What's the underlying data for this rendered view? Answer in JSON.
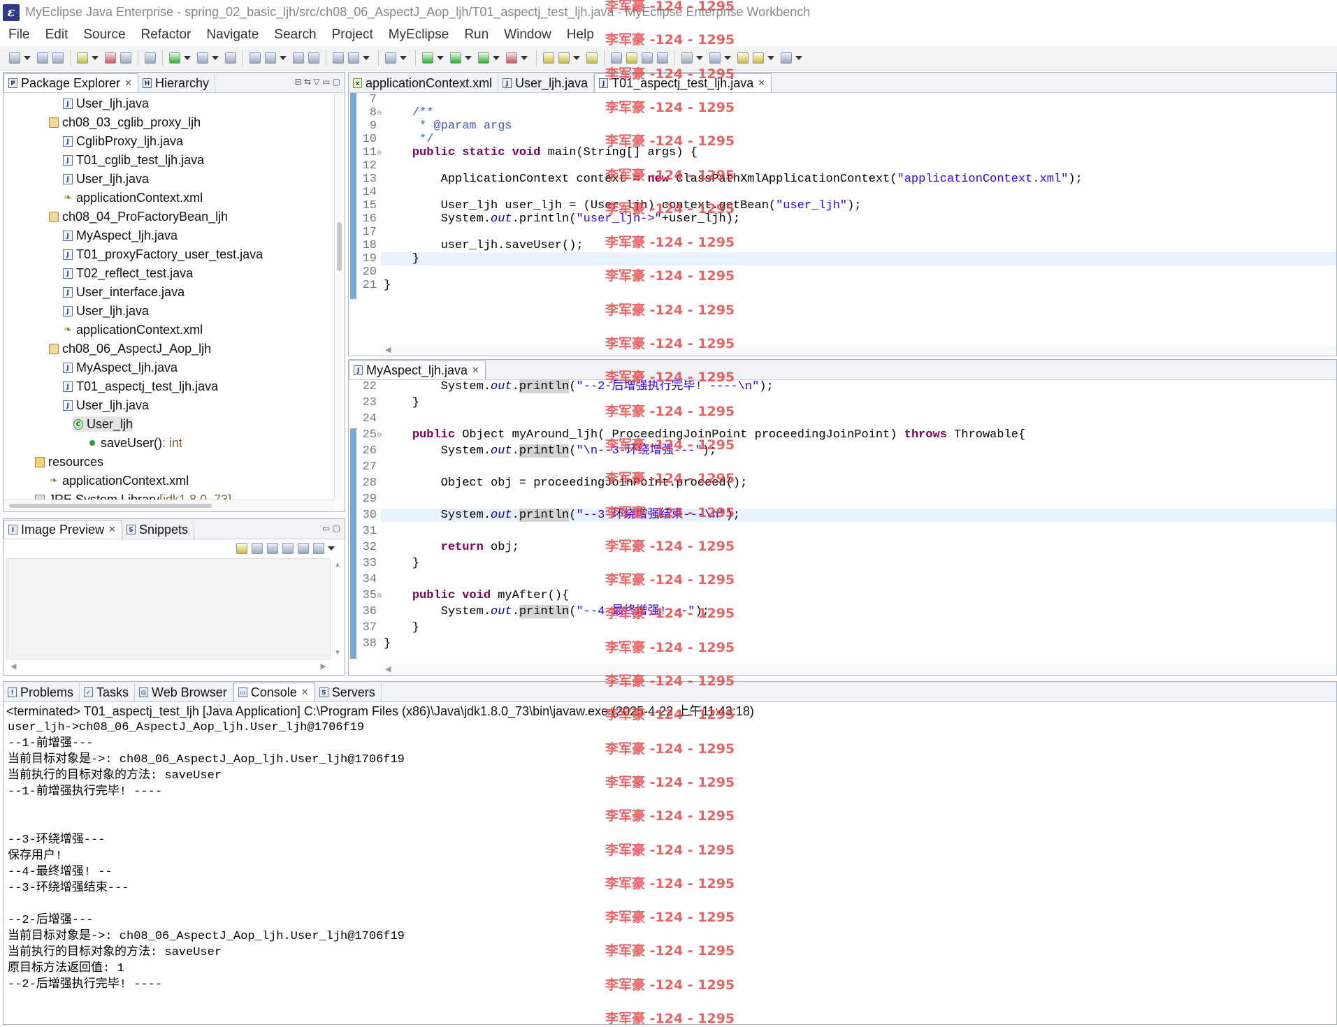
{
  "window": {
    "title": "MyEclipse Java Enterprise - spring_02_basic_ljh/src/ch08_06_AspectJ_Aop_ljh/T01_aspectj_test_ljh.java - MyEclipse Enterprise Workbench"
  },
  "menu": [
    "File",
    "Edit",
    "Source",
    "Refactor",
    "Navigate",
    "Search",
    "Project",
    "MyEclipse",
    "Run",
    "Window",
    "Help"
  ],
  "package_explorer": {
    "tabs": [
      {
        "label": "Package Explorer",
        "close": "✕"
      },
      {
        "label": "Hierarchy"
      }
    ],
    "items": [
      {
        "label": "User_ljh.java",
        "kind": "java"
      },
      {
        "label": "ch08_03_cglib_proxy_ljh",
        "kind": "pkg"
      },
      {
        "label": "CglibProxy_ljh.java",
        "kind": "java"
      },
      {
        "label": "T01_cglib_test_ljh.java",
        "kind": "java"
      },
      {
        "label": "User_ljh.java",
        "kind": "java"
      },
      {
        "label": "applicationContext.xml",
        "kind": "xml"
      },
      {
        "label": "ch08_04_ProFactoryBean_ljh",
        "kind": "pkg"
      },
      {
        "label": "MyAspect_ljh.java",
        "kind": "java"
      },
      {
        "label": "T01_proxyFactory_user_test.java",
        "kind": "java"
      },
      {
        "label": "T02_reflect_test.java",
        "kind": "java"
      },
      {
        "label": "User_interface.java",
        "kind": "java"
      },
      {
        "label": "User_ljh.java",
        "kind": "java"
      },
      {
        "label": "applicationContext.xml",
        "kind": "xml"
      },
      {
        "label": "ch08_06_AspectJ_Aop_ljh",
        "kind": "pkg"
      },
      {
        "label": "MyAspect_ljh.java",
        "kind": "java"
      },
      {
        "label": "T01_aspectj_test_ljh.java",
        "kind": "java"
      },
      {
        "label": "User_ljh.java",
        "kind": "java"
      },
      {
        "label": "User_ljh",
        "kind": "class"
      },
      {
        "label": "saveUser()",
        "kind": "method",
        "suffix": " : int"
      },
      {
        "label": "resources",
        "kind": "res"
      },
      {
        "label": "applicationContext.xml",
        "kind": "xml"
      },
      {
        "label": "JRE System Library",
        "kind": "lib",
        "suffix": " [jdk1.8.0_73]"
      }
    ]
  },
  "image_preview": {
    "tabs": [
      {
        "label": "Image Preview",
        "close": "✕"
      },
      {
        "label": "Snippets"
      }
    ]
  },
  "editor_top": {
    "tabs": [
      {
        "label": "applicationContext.xml"
      },
      {
        "label": "User_ljh.java"
      },
      {
        "label": "T01_aspectj_test_ljh.java",
        "close": "✕"
      }
    ],
    "line_numbers": [
      "7",
      "8",
      "9",
      "10",
      "11",
      "12",
      "13",
      "14",
      "15",
      "16",
      "17",
      "18",
      "19",
      "20",
      "21"
    ],
    "fold_lines": [
      "8",
      "11"
    ]
  },
  "editor_bottom": {
    "tabs": [
      {
        "label": "MyAspect_ljh.java",
        "close": "✕"
      }
    ],
    "line_numbers": [
      "22",
      "23",
      "24",
      "25",
      "26",
      "27",
      "28",
      "29",
      "30",
      "31",
      "32",
      "33",
      "34",
      "35",
      "36",
      "37",
      "38"
    ],
    "fold_lines": [
      "25",
      "35"
    ]
  },
  "console": {
    "tabs": [
      {
        "label": "Problems"
      },
      {
        "label": "Tasks"
      },
      {
        "label": "Web Browser"
      },
      {
        "label": "Console",
        "close": "✕"
      },
      {
        "label": "Servers"
      }
    ],
    "header": "<terminated> T01_aspectj_test_ljh [Java Application] C:\\Program Files (x86)\\Java\\jdk1.8.0_73\\bin\\javaw.exe (2025-4-22 上午11:43:18)",
    "lines": [
      "user_ljh->ch08_06_AspectJ_Aop_ljh.User_ljh@1706f19",
      "--1-前增强---",
      "当前目标对象是->: ch08_06_AspectJ_Aop_ljh.User_ljh@1706f19",
      "当前执行的目标对象的方法: saveUser",
      "--1-前增强执行完毕! ----",
      "",
      "",
      "--3-环绕增强---",
      "保存用户!",
      "--4-最终增强! --",
      "--3-环绕增强结束---",
      "",
      "--2-后增强---",
      "当前目标对象是->: ch08_06_AspectJ_Aop_ljh.User_ljh@1706f19",
      "当前执行的目标对象的方法: saveUser",
      "原目标方法返回值: 1",
      "--2-后增强执行完毕! ----"
    ]
  },
  "watermark": {
    "text": "李军豪 -124 - 1295",
    "color": "#e63c3c"
  }
}
